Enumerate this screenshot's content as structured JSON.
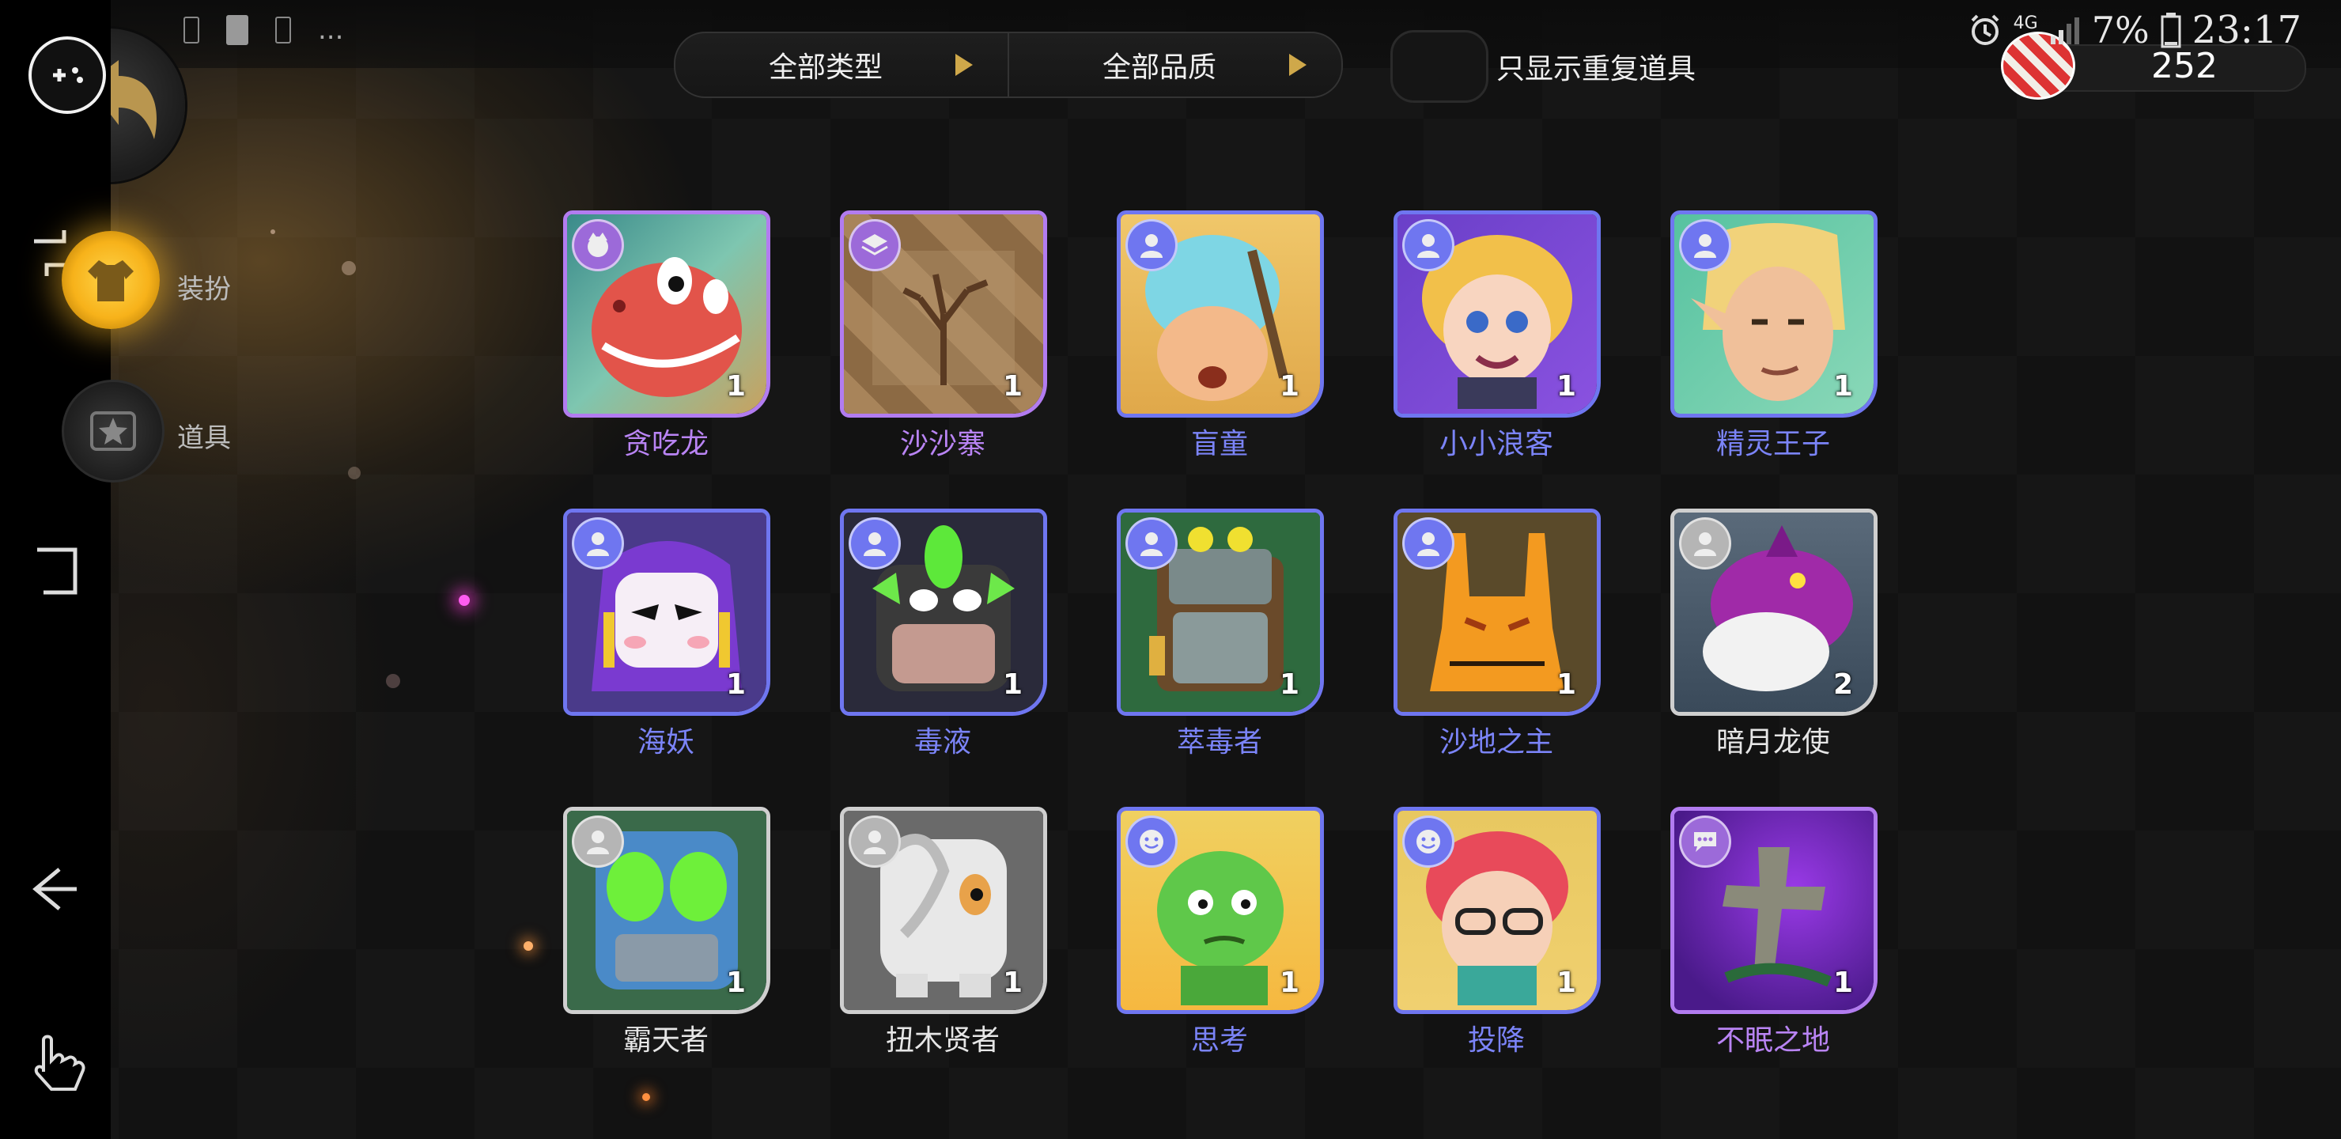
{
  "colors": {
    "epic": "#b27cf0",
    "rare": "#6f76f0",
    "common": "#cfcfcf",
    "accent_gold": "#f7b21a"
  },
  "status_bar": {
    "left_overflow": "...",
    "network": "4G",
    "battery": "7%",
    "time": "23:17"
  },
  "filters": {
    "type_label": "全部类型",
    "quality_label": "全部品质",
    "duplicate_toggle_label": "只显示重复道具",
    "duplicate_toggle_on": false
  },
  "currency": {
    "amount": "252"
  },
  "sidebar": {
    "tabs": [
      {
        "label": "装扮",
        "icon": "outfit-icon",
        "active": true
      },
      {
        "label": "道具",
        "icon": "item-star-icon",
        "active": false
      }
    ]
  },
  "items": [
    {
      "name": "贪吃龙",
      "count": "1",
      "quality": "epic",
      "badge_icon": "avatar-icon"
    },
    {
      "name": "沙沙寨",
      "count": "1",
      "quality": "epic",
      "badge_icon": "board-icon"
    },
    {
      "name": "盲童",
      "count": "1",
      "quality": "rare",
      "badge_icon": "person-icon"
    },
    {
      "name": "小小浪客",
      "count": "1",
      "quality": "rare",
      "badge_icon": "person-icon"
    },
    {
      "name": "精灵王子",
      "count": "1",
      "quality": "rare",
      "badge_icon": "person-icon"
    },
    {
      "name": "海妖",
      "count": "1",
      "quality": "rare",
      "badge_icon": "person-icon"
    },
    {
      "name": "毒液",
      "count": "1",
      "quality": "rare",
      "badge_icon": "person-icon"
    },
    {
      "name": "萃毒者",
      "count": "1",
      "quality": "rare",
      "badge_icon": "person-icon"
    },
    {
      "name": "沙地之主",
      "count": "1",
      "quality": "rare",
      "badge_icon": "person-icon"
    },
    {
      "name": "暗月龙使",
      "count": "2",
      "quality": "common",
      "badge_icon": "person-icon"
    },
    {
      "name": "霸天者",
      "count": "1",
      "quality": "common",
      "badge_icon": "person-icon"
    },
    {
      "name": "扭木贤者",
      "count": "1",
      "quality": "common",
      "badge_icon": "person-icon"
    },
    {
      "name": "思考",
      "count": "1",
      "quality": "rare",
      "badge_icon": "emote-icon"
    },
    {
      "name": "投降",
      "count": "1",
      "quality": "rare",
      "badge_icon": "emote-icon"
    },
    {
      "name": "不眠之地",
      "count": "1",
      "quality": "epic",
      "badge_icon": "chat-icon"
    }
  ]
}
